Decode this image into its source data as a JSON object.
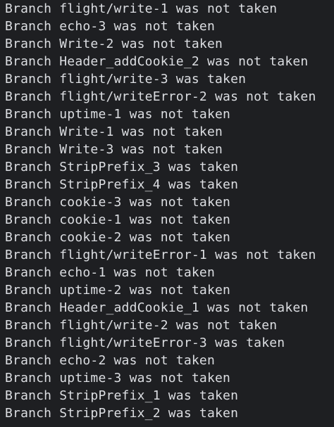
{
  "terminal": {
    "lines": [
      "Branch flight/write-1 was not taken",
      "Branch echo-3 was not taken",
      "Branch Write-2 was not taken",
      "Branch Header_addCookie_2 was not taken",
      "Branch flight/write-3 was taken",
      "Branch flight/writeError-2 was not taken",
      "Branch uptime-1 was not taken",
      "Branch Write-1 was not taken",
      "Branch Write-3 was not taken",
      "Branch StripPrefix_3 was taken",
      "Branch StripPrefix_4 was taken",
      "Branch cookie-3 was not taken",
      "Branch cookie-1 was not taken",
      "Branch cookie-2 was not taken",
      "Branch flight/writeError-1 was not taken",
      "Branch echo-1 was not taken",
      "Branch uptime-2 was not taken",
      "Branch Header_addCookie_1 was not taken",
      "Branch flight/write-2 was not taken",
      "Branch flight/writeError-3 was taken",
      "Branch echo-2 was not taken",
      "Branch uptime-3 was not taken",
      "Branch StripPrefix_1 was taken",
      "Branch StripPrefix_2 was taken"
    ]
  }
}
